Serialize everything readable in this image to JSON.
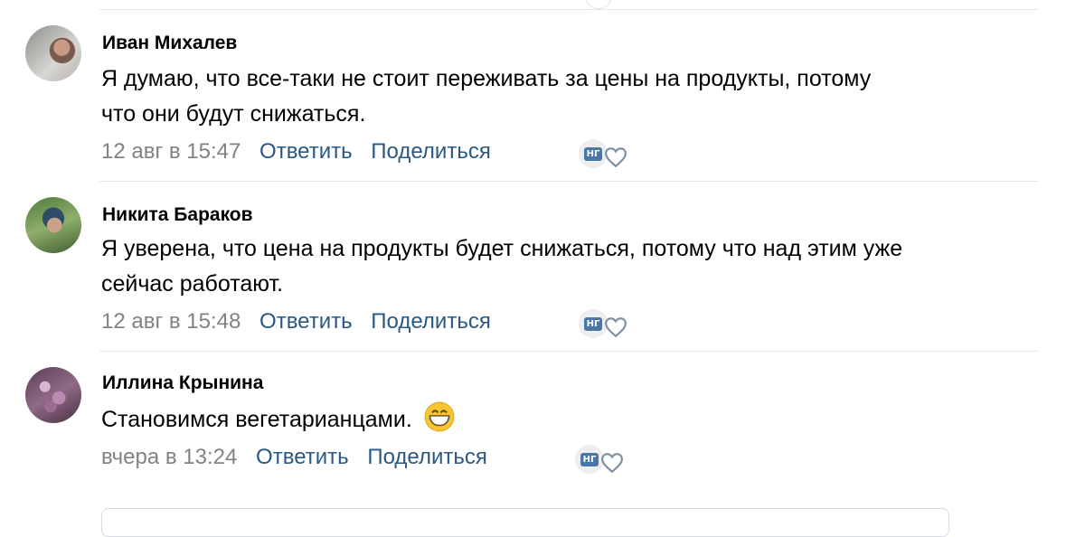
{
  "comments": [
    {
      "author": "Иван Михалев",
      "text_line1": "Я думаю, что все-таки не стоит переживать за цены на продукты, потому",
      "text_line2": "что они будут снижаться.",
      "date": "12 авг в 15:47",
      "reply_label": "Ответить",
      "share_label": "Поделиться",
      "badge": "НГ"
    },
    {
      "author": "Никита Бараков",
      "text_line1": "Я уверена, что цена на продукты будет снижаться, потому что над этим уже",
      "text_line2": "сейчас работают.",
      "date": "12 авг в 15:48",
      "reply_label": "Ответить",
      "share_label": "Поделиться",
      "badge": "НГ"
    },
    {
      "author": "Иллина Крынина",
      "text_line1": "Становимся вегетарианцами.",
      "date": "вчера в 13:24",
      "reply_label": "Ответить",
      "share_label": "Поделиться",
      "badge": "НГ",
      "emoji": "grinning-face-emoji"
    }
  ],
  "colors": {
    "link": "#2a5885",
    "meta": "#828282",
    "divider": "#e7e8ec",
    "badge": "#4a76a8"
  }
}
